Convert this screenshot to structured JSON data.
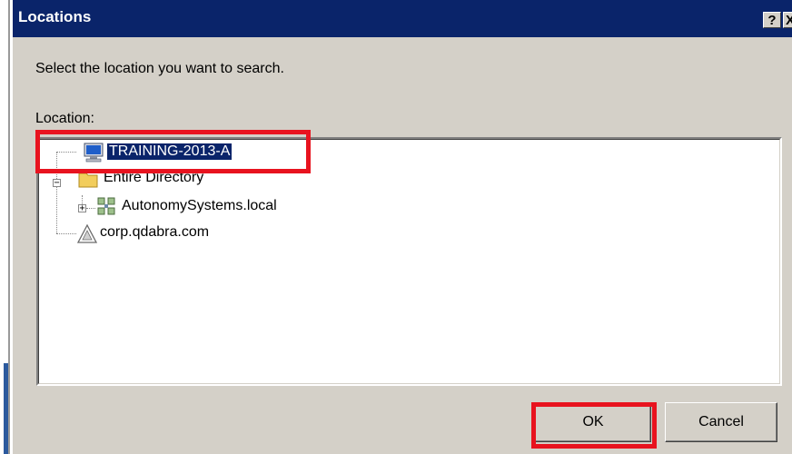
{
  "window": {
    "title": "Locations",
    "help_label": "?",
    "close_label": "X"
  },
  "prompt": "Select the location you want to search.",
  "location_label": "Location:",
  "tree": {
    "items": [
      {
        "label": "TRAINING-2013-A",
        "icon": "computer-icon",
        "selected": true
      },
      {
        "label": "Entire Directory",
        "icon": "folder-icon"
      },
      {
        "label": "AutonomySystems.local",
        "icon": "domain-icon"
      },
      {
        "label": "corp.qdabra.com",
        "icon": "network-icon"
      }
    ]
  },
  "buttons": {
    "ok": "OK",
    "cancel": "Cancel"
  },
  "colors": {
    "titlebar": "#0a246a",
    "dialog_bg": "#d4d0c8",
    "highlight": "#e8131f",
    "selection": "#0a246a"
  }
}
